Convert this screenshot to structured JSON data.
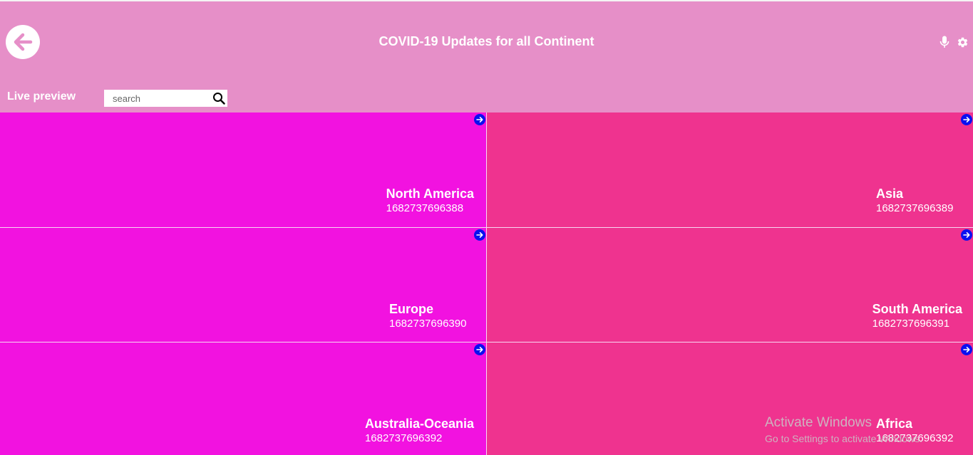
{
  "header": {
    "title": "COVID-19 Updates for all Continent",
    "live_preview_label": "Live preview",
    "background": "#e68fc8"
  },
  "search": {
    "placeholder": "search",
    "value": ""
  },
  "icons": {
    "back": "arrow-left-icon",
    "mic": "microphone-icon",
    "settings": "gear-icon",
    "search": "magnifier-icon",
    "card_link": "arrow-right-circle-icon"
  },
  "colors": {
    "left_tile": "#f212e0",
    "right_tile": "#ef338f",
    "arrow_icon": "#0a10f0"
  },
  "continents": [
    {
      "name": "North America",
      "value": "1682737696388"
    },
    {
      "name": "Asia",
      "value": "1682737696389"
    },
    {
      "name": "Europe",
      "value": "1682737696390"
    },
    {
      "name": "South America",
      "value": "1682737696391"
    },
    {
      "name": "Australia-Oceania",
      "value": "1682737696392"
    },
    {
      "name": "Africa",
      "value": "1682737696392"
    }
  ],
  "watermark": {
    "line1": "Activate Windows",
    "line2": "Go to Settings to activate Windows."
  }
}
